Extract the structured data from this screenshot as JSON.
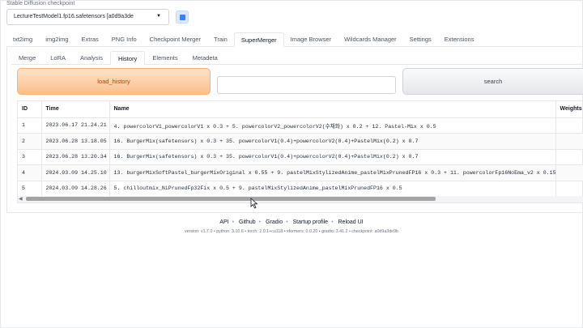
{
  "checkpoint": {
    "label": "Stable Diffusion checkpoint",
    "value": "LectureTestModel1.fp16.safetensors [a0d9a3de"
  },
  "main_tabs": [
    "txt2img",
    "img2img",
    "Extras",
    "PNG Info",
    "Checkpoint Merger",
    "Train",
    "SuperMerger",
    "Image Browser",
    "Wildcards Manager",
    "Settings",
    "Extensions"
  ],
  "active_main_tab": "SuperMerger",
  "sub_tabs": [
    "Merge",
    "LoRA",
    "Analysis",
    "History",
    "Elements",
    "Metadeta"
  ],
  "active_sub_tab": "History",
  "load_history_label": "load_history",
  "search_placeholder": "",
  "search_button_label": "search",
  "table": {
    "headers": [
      "ID",
      "Time",
      "Name",
      "Weights"
    ],
    "rows": [
      [
        "1",
        "2023.06.17 21.24.21",
        "4. powercolorV1_powercolorV1 x 0.3 + 5. powercolorV2_powercolorV2(수채화) x 0.2 + 12. Pastel-Mix x 0.5",
        ""
      ],
      [
        "2",
        "2023.06.28 13.18.05",
        "16. BurgerMix(safetensors) x 0.3 + 35. powercolorV1(0.4)+powercolorV2(0.4)+PastelMix(0.2) x 0.7",
        ""
      ],
      [
        "3",
        "2023.06.28 13.20.34",
        "16. BurgerMix(safetensors) x 0.3 + 35. powercolorV1(0.4)+powercolorV2(0.4)+PastelMix(0.2) x 0.7",
        ""
      ],
      [
        "4",
        "2024.03.09 14.25.10",
        "13. burgerMixSoftPastel_burgerMixOriginal x 0.55 + 9. pastelMixStylizedAnime_pastelMixPrunedFP16 x 0.3 + 11. powercolorFp16NoEma_v2 x 0.15",
        ""
      ],
      [
        "5",
        "2024.03.09 14.28.26",
        "5. chilloutmix_NiPrunedFp32Fix x 0.5 + 9. pastelMixStylizedAnime_pastelMixPrunedFP16 x 0.5",
        ""
      ]
    ]
  },
  "scroll": {
    "position_fraction": 0.0,
    "visible_fraction": 0.72
  },
  "footer": {
    "links": [
      "API",
      "Github",
      "Gradio",
      "Startup profile",
      "Reload UI"
    ],
    "separator": "•",
    "version_text": "version: v1.7.0  •  python: 3.10.6  •  torch: 2.0.1+cu118  •  xformers: 0.0.20  •  gradio: 3.41.2  •  checkpoint: a0d9a3de9b"
  },
  "colors": {
    "accent_orange": "#fbbf8c",
    "accent_orange_text": "#c2410c",
    "refresh_blue": "#3b82f6"
  }
}
